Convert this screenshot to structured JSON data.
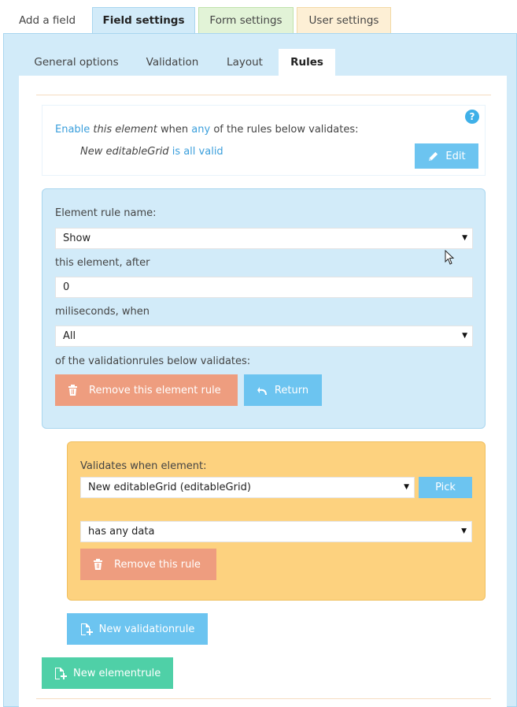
{
  "top_tabs": [
    {
      "label": "Add a field"
    },
    {
      "label": "Field settings"
    },
    {
      "label": "Form settings"
    },
    {
      "label": "User settings"
    }
  ],
  "sub_tabs": [
    {
      "label": "General options"
    },
    {
      "label": "Validation"
    },
    {
      "label": "Layout"
    },
    {
      "label": "Rules"
    }
  ],
  "summary": {
    "help_label": "?",
    "line1": {
      "enable": "Enable",
      "this_element": "this element",
      "when": "when",
      "any": "any",
      "rest": "of the rules below validates:"
    },
    "line2": {
      "element_name": "New editableGrid",
      "condition": "is all valid"
    },
    "edit_button": "Edit"
  },
  "element_rule": {
    "name_label": "Element rule name:",
    "name_value": "Show",
    "after_label": "this element, after",
    "ms_value": "0",
    "when_label": "miliseconds, when",
    "when_value": "All",
    "below_label": "of the validationrules below validates:",
    "remove_button": "Remove this element rule",
    "return_button": "Return"
  },
  "validation_rule": {
    "label": "Validates when element:",
    "element_value": "New editableGrid (editableGrid)",
    "pick_button": "Pick",
    "condition_value": "has any data",
    "remove_button": "Remove this rule"
  },
  "new_validationrule_button": "New validationrule",
  "new_elementrule_button": "New elementrule",
  "colors": {
    "panel_blue": "#d2ebf9",
    "button_blue": "#6cc4f0",
    "button_red": "#ee9d7f",
    "orange_box": "#fdd27f",
    "button_green": "#4fd0a7"
  }
}
